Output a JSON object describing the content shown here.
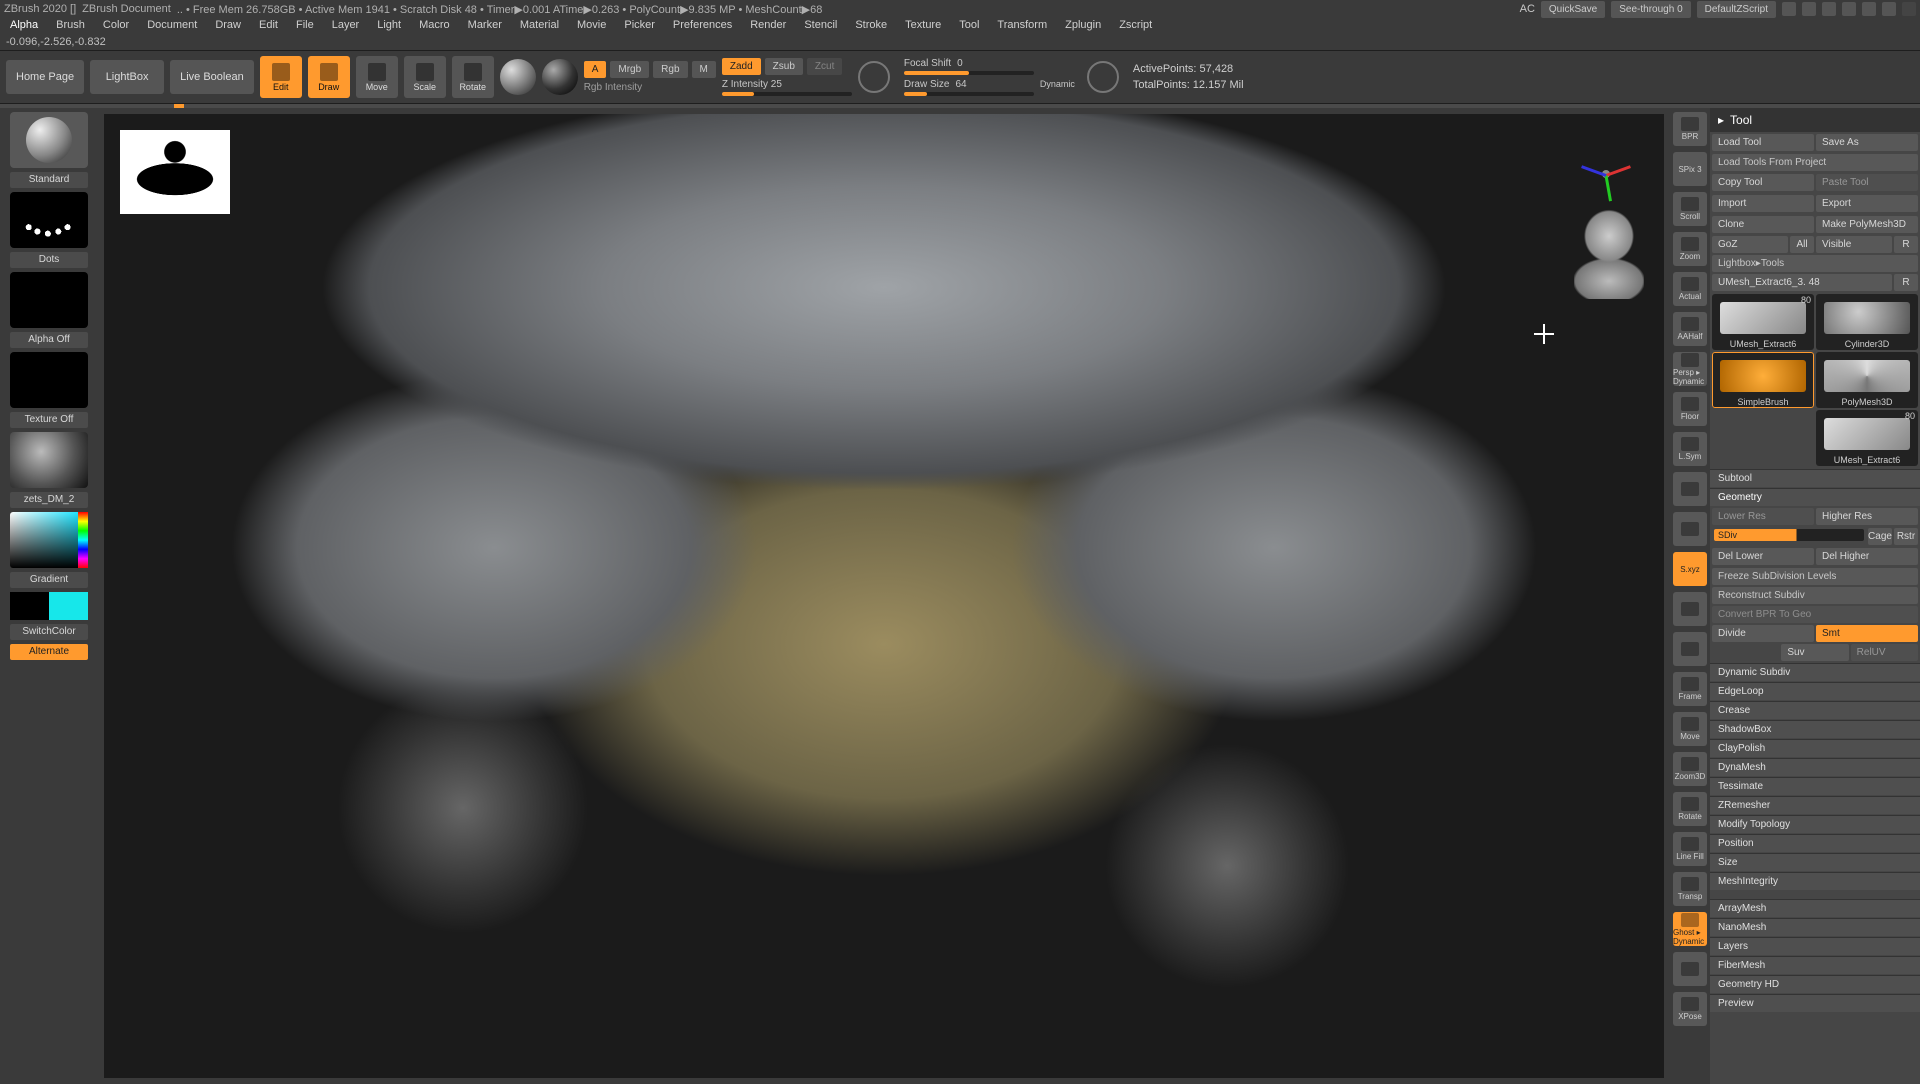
{
  "titlebar": {
    "app": "ZBrush 2020 []",
    "doc": "ZBrush Document",
    "mem": ".. • Free Mem 26.758GB • Active Mem 1941 • Scratch Disk 48 • Timer▶0.001 ATime▶0.263 • PolyCount▶9.835 MP • MeshCount▶68",
    "right": {
      "ac": "AC",
      "quicksave": "QuickSave",
      "seethrough": "See-through  0",
      "defscript": "DefaultZScript"
    }
  },
  "menus": [
    "Alpha",
    "Brush",
    "Color",
    "Document",
    "Draw",
    "Edit",
    "File",
    "Layer",
    "Light",
    "Macro",
    "Marker",
    "Material",
    "Movie",
    "Picker",
    "Preferences",
    "Render",
    "Stencil",
    "Stroke",
    "Texture",
    "Tool",
    "Transform",
    "Zplugin",
    "Zscript"
  ],
  "coord": "-0.096,-2.526,-0.832",
  "shelf": {
    "home": "Home Page",
    "lightbox": "LightBox",
    "liveboolean": "Live Boolean",
    "edit": "Edit",
    "draw": "Draw",
    "move": "Move",
    "scale": "Scale",
    "rotate": "Rotate",
    "ltr": {
      "a": "A",
      "mrgb": "Mrgb",
      "rgb": "Rgb",
      "m": "M",
      "rgbint": "Rgb Intensity"
    },
    "zadd": "Zadd",
    "zsub": "Zsub",
    "zcut": "Zcut",
    "zint": "Z Intensity 25",
    "focal": {
      "label": "Focal Shift",
      "val": "0"
    },
    "drawsize": {
      "label": "Draw Size",
      "val": "64"
    },
    "dynamic": "Dynamic",
    "active": "ActivePoints: 57,428",
    "total": "TotalPoints: 12.157 Mil"
  },
  "left": {
    "brush": "Standard",
    "stroke": "Dots",
    "alpha": "Alpha Off",
    "texture": "Texture Off",
    "material": "zets_DM_2",
    "gradient": "Gradient",
    "switch": "SwitchColor",
    "alternate": "Alternate"
  },
  "rail": [
    "BPR",
    "SPix 3",
    "Scroll",
    "Zoom",
    "Actual",
    "AAHalf",
    "Persp ▸ Dynamic",
    "Floor",
    "L.Sym",
    "",
    "",
    "S.xyz",
    "",
    "",
    "Frame",
    "Move",
    "Zoom3D",
    "Rotate",
    "Line Fill",
    "Transp",
    "Ghost ▸ Dynamic",
    "",
    "XPose"
  ],
  "rail_on": [
    11
  ],
  "tool": {
    "title": "Tool",
    "row1": [
      "Load Tool",
      "Save As"
    ],
    "row2": "Load Tools From Project",
    "row3": [
      "Copy Tool",
      "Paste Tool"
    ],
    "row4": [
      "Import",
      "Export"
    ],
    "row5": [
      "Clone",
      "Make PolyMesh3D"
    ],
    "row6": [
      "GoZ",
      "All",
      "Visible",
      "R"
    ],
    "row7": "Lightbox▸Tools",
    "active": "UMesh_Extract6_3. 48",
    "activeR": "R",
    "thumbs": [
      {
        "n": "80",
        "cap": "UMesh_Extract6"
      },
      {
        "n": "",
        "cap": "Cylinder3D"
      },
      {
        "n": "",
        "cap": "SimpleBrush",
        "sel": true
      },
      {
        "n": "",
        "cap": "PolyMesh3D"
      },
      {
        "n": "",
        "cap": ""
      },
      {
        "n": "80",
        "cap": "UMesh_Extract6"
      }
    ],
    "sub": "Subtool",
    "geo": {
      "title": "Geometry",
      "res": [
        "Lower Res",
        "Higher Res"
      ],
      "sdiv": "SDiv",
      "cage": "Cage",
      "rstr": "Rstr",
      "del": [
        "Del Lower",
        "Del Higher"
      ],
      "freeze": "Freeze SubDivision Levels",
      "recon": "Reconstruct Subdiv",
      "convert": "Convert BPR To Geo",
      "divide": "Divide",
      "smt": "Smt",
      "suv": "Suv",
      "reluv": "RelUV",
      "acc": [
        "Dynamic Subdiv",
        "EdgeLoop",
        "Crease",
        "ShadowBox",
        "ClayPolish",
        "DynaMesh",
        "Tessimate",
        "ZRemesher",
        "Modify Topology",
        "Position",
        "Size",
        "MeshIntegrity"
      ],
      "acc2": [
        "ArrayMesh",
        "NanoMesh",
        "Layers",
        "FiberMesh",
        "Geometry HD",
        "Preview"
      ]
    }
  }
}
